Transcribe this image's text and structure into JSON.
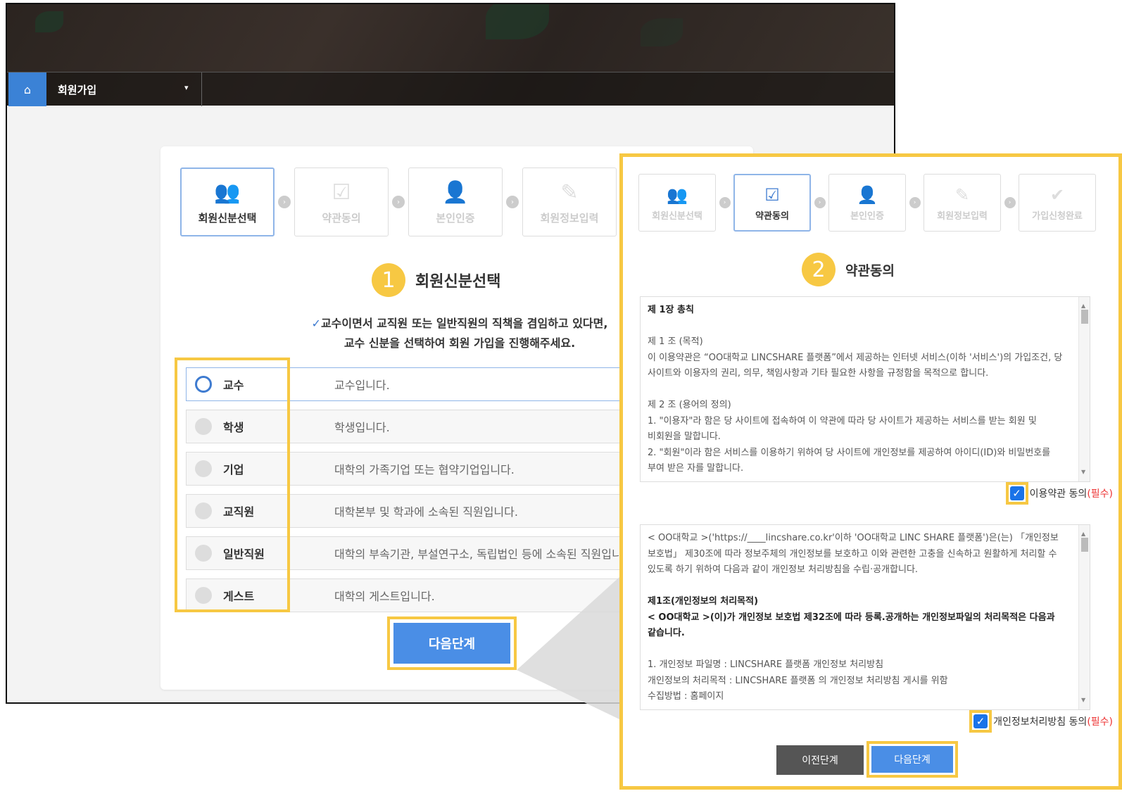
{
  "nav": {
    "home_icon": "home-icon",
    "title": "회원가입",
    "caret": "▾"
  },
  "steps": [
    {
      "label": "회원신분선택",
      "icon": "group-icon"
    },
    {
      "label": "약관동의",
      "icon": "checkbox-icon"
    },
    {
      "label": "본인인증",
      "icon": "user-check-icon"
    },
    {
      "label": "회원정보입력",
      "icon": "edit-icon"
    },
    {
      "label": "가입신청완료",
      "icon": "check-circle-icon"
    }
  ],
  "page1": {
    "number": "1",
    "title": "회원신분선택",
    "notice_line1": "교수이면서 교직원 또는 일반직원의 직책을 겸임하고 있다면,",
    "notice_line2": "교수 신분을 선택하여 회원 가입을 진행해주세요.",
    "roles": [
      {
        "name": "교수",
        "desc": "교수입니다.",
        "selected": true
      },
      {
        "name": "학생",
        "desc": "학생입니다.",
        "selected": false
      },
      {
        "name": "기업",
        "desc": "대학의 가족기업 또는 협약기업입니다.",
        "selected": false
      },
      {
        "name": "교직원",
        "desc": "대학본부 및 학과에 소속된 직원입니다.",
        "selected": false
      },
      {
        "name": "일반직원",
        "desc": "대학의 부속기관, 부설연구소, 독립법인 등에 소속된 직원입니다.",
        "selected": false
      },
      {
        "name": "게스트",
        "desc": "대학의 게스트입니다.",
        "selected": false
      }
    ],
    "next_label": "다음단계"
  },
  "page2": {
    "number": "2",
    "title": "약관동의",
    "terms1": {
      "heading": "제 1장 총칙",
      "art1_title": "제 1 조 (목적)",
      "art1_l1": "이 이용약관은 “OO대학교 LINCSHARE 플랫폼”에서 제공하는 인터넷 서비스(이하 '서비스')의 가입조건, 당",
      "art1_l2": "사이트와 이용자의 권리, 의무, 책임사항과 기타 필요한 사항을 규정함을 목적으로 합니다.",
      "art2_title": "제 2 조 (용어의 정의)",
      "art2_l1": "1. \"이용자\"라 함은 당 사이트에 접속하여 이 약관에 따라 당 사이트가 제공하는 서비스를 받는 회원 및",
      "art2_l2": "비회원을 말합니다.",
      "art2_l3": "2. \"회원\"이라 함은 서비스를 이용하기 위하여 당 사이트에 개인정보를 제공하여 아이디(ID)와 비밀번호를",
      "art2_l4": "부여 받은 자를 말합니다."
    },
    "agree1_label": "이용약관 동의",
    "agree1_req": "(필수)",
    "terms2": {
      "p1_l1": "< OO대학교 >('https://____lincshare.co.kr'이하 'OO대학교 LINC SHARE 플랫폼')은(는) 「개인정보",
      "p1_l2": "보호법」 제30조에 따라 정보주체의 개인정보를 보호하고 이와 관련한 고충을 신속하고 원활하게 처리할 수",
      "p1_l3": "있도록 하기 위하여 다음과 같이 개인정보 처리방침을 수립·공개합니다.",
      "art1_title": "제1조(개인정보의 처리목적)",
      "art1_l1": "< OO대학교 >(이)가 개인정보 보호법 제32조에 따라 등록.공개하는 개인정보파일의 처리목적은 다음과",
      "art1_l2": "같습니다.",
      "item_l1": "1. 개인정보 파일명 : LINCSHARE 플랫폼 개인정보 처리방침",
      "item_l2": "개인정보의 처리목적 : LINCSHARE 플랫폼 의 개인정보 처리방침 게시를 위함",
      "item_l3": "수집방법 : 홈페이지"
    },
    "agree2_label": "개인정보처리방침 동의",
    "agree2_req": "(필수)",
    "prev_label": "이전단계",
    "next_label": "다음단계"
  },
  "colors": {
    "accent": "#4a8ee6",
    "highlight": "#f7c843",
    "required": "#e33333"
  }
}
